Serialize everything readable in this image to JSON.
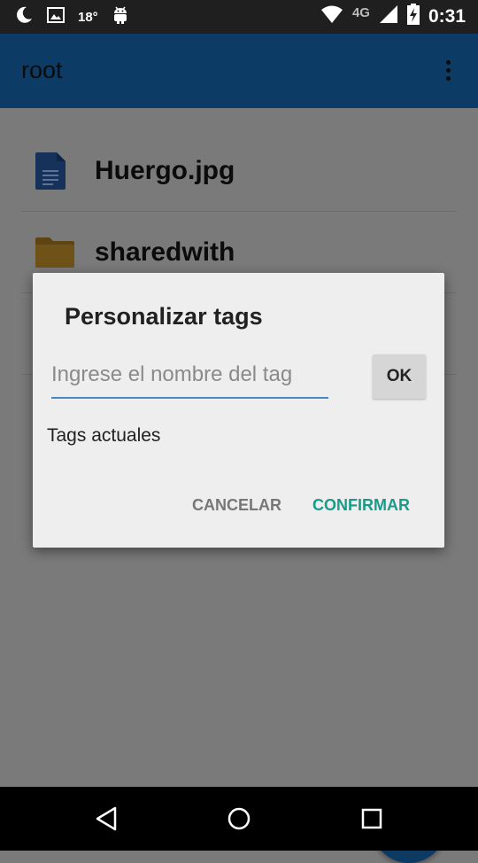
{
  "status_bar": {
    "temperature": "18°",
    "network": "4G",
    "time": "0:31",
    "icons": [
      "moon-icon",
      "image-icon",
      "android-icon",
      "wifi-icon",
      "signal-icon",
      "battery-charging-icon"
    ]
  },
  "app_bar": {
    "title": "root",
    "menu_icon": "overflow-menu-icon",
    "color": "#0c3c66"
  },
  "file_list": [
    {
      "name": "Huergo.jpg",
      "icon": "document-icon"
    },
    {
      "name": "sharedwith",
      "icon": "folder-icon"
    }
  ],
  "dialog": {
    "title": "Personalizar tags",
    "input_placeholder": "Ingrese el nombre del tag",
    "input_value": "",
    "ok_label": "OK",
    "tags_label": "Tags actuales",
    "cancel_label": "CANCELAR",
    "confirm_label": "CONFIRMAR",
    "accent_color": "#1a9a8a"
  },
  "fab": {
    "icon": "plus-icon"
  },
  "nav_bar": {
    "icons": [
      "back-icon",
      "home-icon",
      "recents-icon"
    ]
  }
}
